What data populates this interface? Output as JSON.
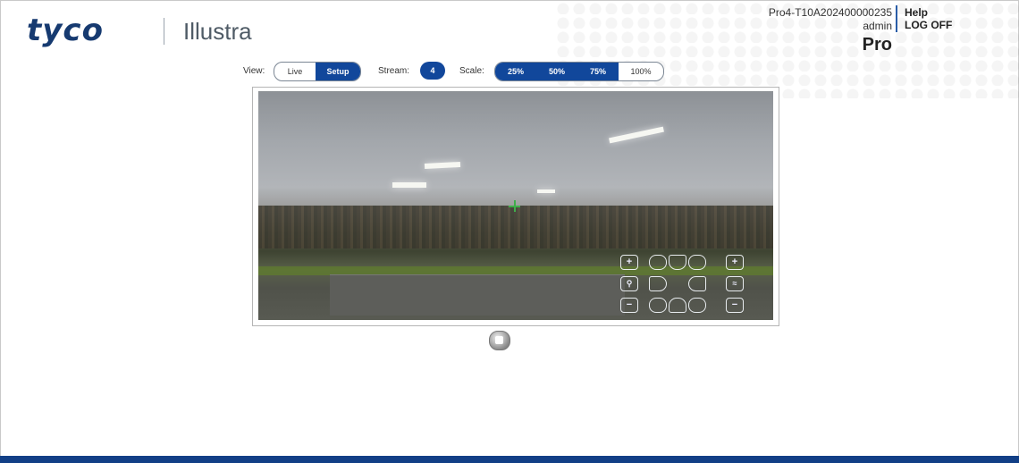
{
  "brand": {
    "logo": "tyco",
    "product": "Illustra"
  },
  "device": {
    "name": "Pro4-T10A202400000235",
    "user": "admin",
    "model": "Pro"
  },
  "nav": {
    "help": "Help",
    "logoff": "LOG OFF"
  },
  "toolbar": {
    "view_label": "View:",
    "view_options": [
      "Live",
      "Setup"
    ],
    "view_selected": "Setup",
    "stream_label": "Stream:",
    "stream_value": "4",
    "scale_label": "Scale:",
    "scale_options": [
      "25%",
      "50%",
      "75%",
      "100%"
    ],
    "scale_selected": "100%"
  },
  "video": {
    "ptz_icons": [
      "zoom-in-icon",
      "iris-open-icon",
      "focus-near-icon",
      "pan-up-icon",
      "zoom-out-icon",
      "magnify-icon",
      "pan-left-icon",
      "pan-right-icon",
      "preset-icon",
      "pan-down-icon",
      "focus-far-icon",
      "iris-close-icon"
    ]
  },
  "controls": {
    "stop_icon": "stop-icon"
  },
  "colors": {
    "primary": "#11479b",
    "footer": "#123f86"
  }
}
